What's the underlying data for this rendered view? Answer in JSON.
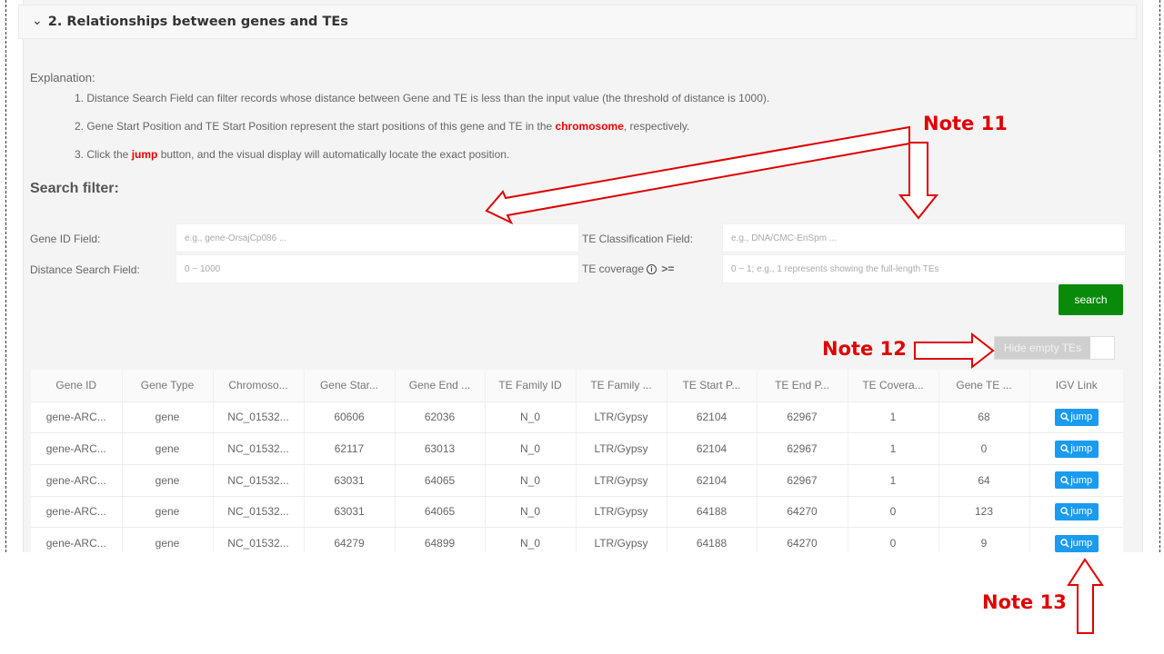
{
  "section": {
    "chevron_icon": "chevron-down-icon",
    "title": "2. Relationships between genes and TEs"
  },
  "explanation": {
    "label": "Explanation:",
    "items": [
      {
        "parts": [
          {
            "text": "1. Distance Search Field can filter records whose distance between Gene and TE is less than the input value (the threshold of distance is 1000).",
            "highlight": false
          }
        ]
      },
      {
        "parts": [
          {
            "text": "2. Gene Start Position and TE Start Position represent the start positions of this gene and TE in the ",
            "highlight": false
          },
          {
            "text": "chromosome",
            "highlight": true
          },
          {
            "text": ", respectively.",
            "highlight": false
          }
        ]
      },
      {
        "parts": [
          {
            "text": "3. Click the ",
            "highlight": false
          },
          {
            "text": "jump",
            "highlight": true
          },
          {
            "text": " button, and the visual display will automatically locate the exact position.",
            "highlight": false
          }
        ]
      }
    ]
  },
  "search_filter": {
    "title": "Search filter:",
    "gene_id": {
      "label": "Gene ID Field:",
      "value": "",
      "placeholder": "e.g., gene-OrsajCp086 ..."
    },
    "distance": {
      "label": "Distance Search Field:",
      "value": "",
      "placeholder": "0 ~ 1000"
    },
    "te_class": {
      "label": "TE Classification Field:",
      "value": "",
      "placeholder": "e.g., DNA/CMC-EnSpm ..."
    },
    "te_coverage": {
      "label": "TE coverage",
      "info_icon": "info-icon",
      "operator": ">=",
      "value": "",
      "placeholder": "0 ~ 1; e.g., 1 represents showing the full-length TEs"
    },
    "search_label": "search"
  },
  "toggle": {
    "label": "Hide empty TEs",
    "on": false
  },
  "table": {
    "columns": [
      "Gene ID",
      "Gene Type",
      "Chromoso...",
      "Gene Star...",
      "Gene End ...",
      "TE Family ID",
      "TE Family ...",
      "TE Start P...",
      "TE End P...",
      "TE Covera...",
      "Gene TE ...",
      "IGV Link"
    ],
    "rows": [
      [
        "gene-ARC...",
        "gene",
        "NC_01532...",
        "60606",
        "62036",
        "N_0",
        "LTR/Gypsy",
        "62104",
        "62967",
        "1",
        "68",
        "jump"
      ],
      [
        "gene-ARC...",
        "gene",
        "NC_01532...",
        "62117",
        "63013",
        "N_0",
        "LTR/Gypsy",
        "62104",
        "62967",
        "1",
        "0",
        "jump"
      ],
      [
        "gene-ARC...",
        "gene",
        "NC_01532...",
        "63031",
        "64065",
        "N_0",
        "LTR/Gypsy",
        "62104",
        "62967",
        "1",
        "64",
        "jump"
      ],
      [
        "gene-ARC...",
        "gene",
        "NC_01532...",
        "63031",
        "64065",
        "N_0",
        "LTR/Gypsy",
        "64188",
        "64270",
        "0",
        "123",
        "jump"
      ],
      [
        "gene-ARC...",
        "gene",
        "NC_01532...",
        "64279",
        "64899",
        "N_0",
        "LTR/Gypsy",
        "64188",
        "64270",
        "0",
        "9",
        "jump"
      ]
    ],
    "jump_icon": "search-icon"
  },
  "annotations": {
    "note11": "Note 11",
    "note12": "Note 12",
    "note13": "Note 13",
    "color": "#e00000"
  },
  "colors": {
    "search_button": "#0a8a0a",
    "jump_button": "#1a9bf0",
    "highlight": "#e00000"
  }
}
